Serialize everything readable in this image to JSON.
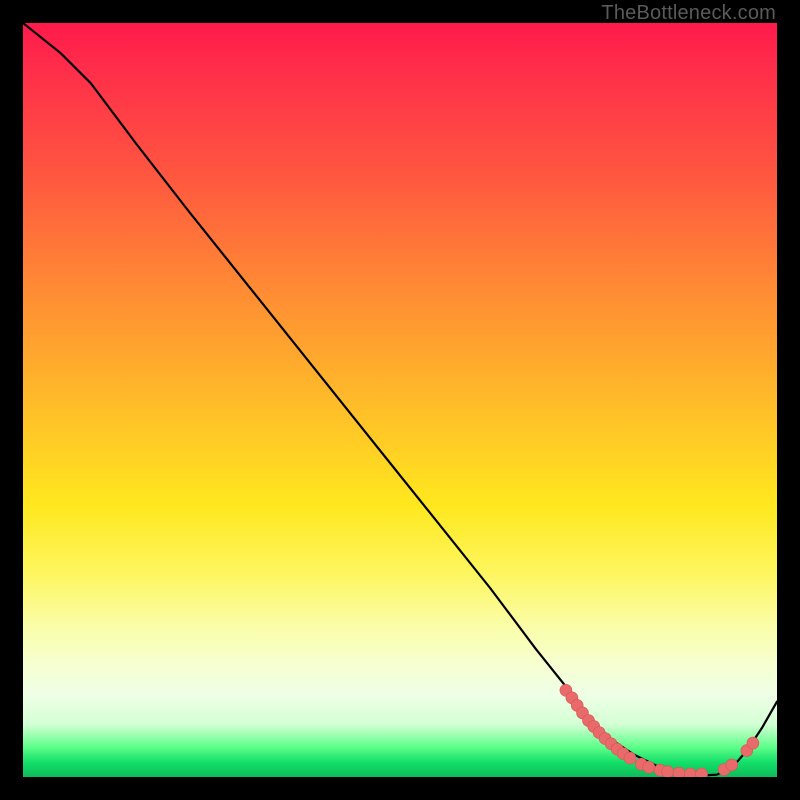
{
  "watermark": "TheBottleneck.com",
  "colors": {
    "frame_bg": "#000000",
    "gradient_top": "#ff1a4b",
    "gradient_mid": "#ffe81e",
    "gradient_bottom": "#0dbb5a",
    "curve_stroke": "#000000",
    "marker_fill": "#e86a6a"
  },
  "chart_data": {
    "type": "line",
    "title": "",
    "xlabel": "",
    "ylabel": "",
    "xlim": [
      0,
      100
    ],
    "ylim": [
      0,
      100
    ],
    "grid": false,
    "legend": false,
    "annotations": [
      "TheBottleneck.com"
    ],
    "series": [
      {
        "name": "bottleneck-curve",
        "x": [
          0,
          5,
          9,
          15,
          22,
          30,
          38,
          46,
          54,
          62,
          68,
          72,
          75,
          78,
          81,
          84,
          86,
          88,
          90,
          92,
          94,
          96,
          98,
          100
        ],
        "y": [
          100,
          96,
          92,
          84,
          75,
          65,
          55,
          45,
          35,
          25,
          17,
          12,
          8,
          5,
          3,
          1.5,
          0.8,
          0.4,
          0.2,
          0.3,
          1.2,
          3.5,
          6.5,
          10
        ]
      }
    ],
    "markers": [
      {
        "name": "cluster-point",
        "x": 72.0,
        "y": 11.5
      },
      {
        "name": "cluster-point",
        "x": 72.8,
        "y": 10.5
      },
      {
        "name": "cluster-point",
        "x": 73.5,
        "y": 9.5
      },
      {
        "name": "cluster-point",
        "x": 74.2,
        "y": 8.5
      },
      {
        "name": "cluster-point",
        "x": 75.0,
        "y": 7.5
      },
      {
        "name": "cluster-point",
        "x": 75.7,
        "y": 6.7
      },
      {
        "name": "cluster-point",
        "x": 76.4,
        "y": 5.9
      },
      {
        "name": "cluster-point",
        "x": 77.2,
        "y": 5.1
      },
      {
        "name": "cluster-point",
        "x": 78.0,
        "y": 4.4
      },
      {
        "name": "cluster-point",
        "x": 78.8,
        "y": 3.7
      },
      {
        "name": "cluster-point",
        "x": 79.6,
        "y": 3.1
      },
      {
        "name": "cluster-point",
        "x": 80.5,
        "y": 2.5
      },
      {
        "name": "cluster-point",
        "x": 82.0,
        "y": 1.7
      },
      {
        "name": "cluster-point",
        "x": 83.0,
        "y": 1.3
      },
      {
        "name": "cluster-point",
        "x": 84.5,
        "y": 0.9
      },
      {
        "name": "cluster-point",
        "x": 85.5,
        "y": 0.7
      },
      {
        "name": "cluster-point",
        "x": 87.0,
        "y": 0.5
      },
      {
        "name": "cluster-point",
        "x": 88.5,
        "y": 0.4
      },
      {
        "name": "cluster-point",
        "x": 90.0,
        "y": 0.4
      },
      {
        "name": "cluster-point",
        "x": 93.0,
        "y": 1.0
      },
      {
        "name": "cluster-point",
        "x": 94.0,
        "y": 1.6
      },
      {
        "name": "cluster-point",
        "x": 96.0,
        "y": 3.5
      },
      {
        "name": "cluster-point",
        "x": 96.8,
        "y": 4.5
      }
    ]
  }
}
